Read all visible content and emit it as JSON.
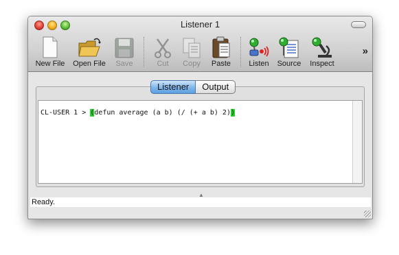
{
  "window": {
    "title": "Listener 1"
  },
  "toolbar": {
    "new_file": "New File",
    "open_file": "Open File",
    "save": "Save",
    "cut": "Cut",
    "copy": "Copy",
    "paste": "Paste",
    "listen": "Listen",
    "source": "Source",
    "inspect": "Inspect",
    "overflow": "»"
  },
  "tabs": {
    "listener": "Listener",
    "output": "Output"
  },
  "editor": {
    "prompt": "CL-USER 1 > ",
    "paren_open": "(",
    "code_body": "defun average (a b) (/ (+ a b) 2)",
    "paren_close": ")"
  },
  "status": {
    "text": "Ready."
  },
  "colors": {
    "paren_highlight": "#22d32a",
    "active_tab": "#7fb6ea"
  }
}
